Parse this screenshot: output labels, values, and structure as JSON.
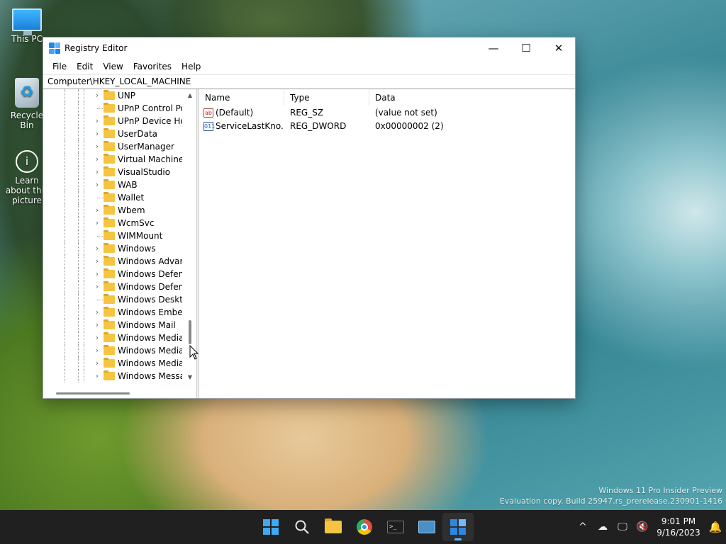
{
  "desktop": {
    "icons": [
      {
        "label": "This PC"
      },
      {
        "label": "Recycle Bin"
      },
      {
        "label": "Learn about this picture"
      }
    ],
    "watermark": {
      "line1": "Windows 11 Pro Insider Preview",
      "line2": "Evaluation copy. Build 25947.rs_prerelease.230901-1416"
    }
  },
  "window": {
    "title": "Registry Editor",
    "controls": {
      "minimize": "—",
      "maximize": "☐",
      "close": "✕"
    },
    "menu": [
      "File",
      "Edit",
      "View",
      "Favorites",
      "Help"
    ],
    "address": "Computer\\HKEY_LOCAL_MACHINE",
    "tree": [
      {
        "label": "UNP",
        "expandable": true
      },
      {
        "label": "UPnP Control Point",
        "expandable": false
      },
      {
        "label": "UPnP Device Host",
        "expandable": true
      },
      {
        "label": "UserData",
        "expandable": true
      },
      {
        "label": "UserManager",
        "expandable": true
      },
      {
        "label": "Virtual Machine",
        "expandable": true
      },
      {
        "label": "VisualStudio",
        "expandable": true
      },
      {
        "label": "WAB",
        "expandable": true
      },
      {
        "label": "Wallet",
        "expandable": false
      },
      {
        "label": "Wbem",
        "expandable": true
      },
      {
        "label": "WcmSvc",
        "expandable": true
      },
      {
        "label": "WIMMount",
        "expandable": false
      },
      {
        "label": "Windows",
        "expandable": true
      },
      {
        "label": "Windows Advanced Threat Protection",
        "expandable": true
      },
      {
        "label": "Windows Defender",
        "expandable": true
      },
      {
        "label": "Windows Defender Security Center",
        "expandable": true
      },
      {
        "label": "Windows Desktop Search",
        "expandable": false
      },
      {
        "label": "Windows Embedded",
        "expandable": true
      },
      {
        "label": "Windows Mail",
        "expandable": true
      },
      {
        "label": "Windows Media Device Manager",
        "expandable": true
      },
      {
        "label": "Windows Media Foundation",
        "expandable": true
      },
      {
        "label": "Windows Media Player NSS",
        "expandable": true
      },
      {
        "label": "Windows Messaging Subsystem",
        "expandable": true
      }
    ],
    "list": {
      "headers": {
        "name": "Name",
        "type": "Type",
        "data": "Data"
      },
      "rows": [
        {
          "icon": "ab",
          "name": "(Default)",
          "type": "REG_SZ",
          "data": "(value not set)"
        },
        {
          "icon": "011",
          "name": "ServiceLastKno...",
          "type": "REG_DWORD",
          "data": "0x00000002 (2)"
        }
      ]
    }
  },
  "taskbar": {
    "clock": {
      "time": "9:01 PM",
      "date": "9/16/2023"
    },
    "tray": {
      "chevron": "^",
      "notification": "🔔"
    }
  }
}
